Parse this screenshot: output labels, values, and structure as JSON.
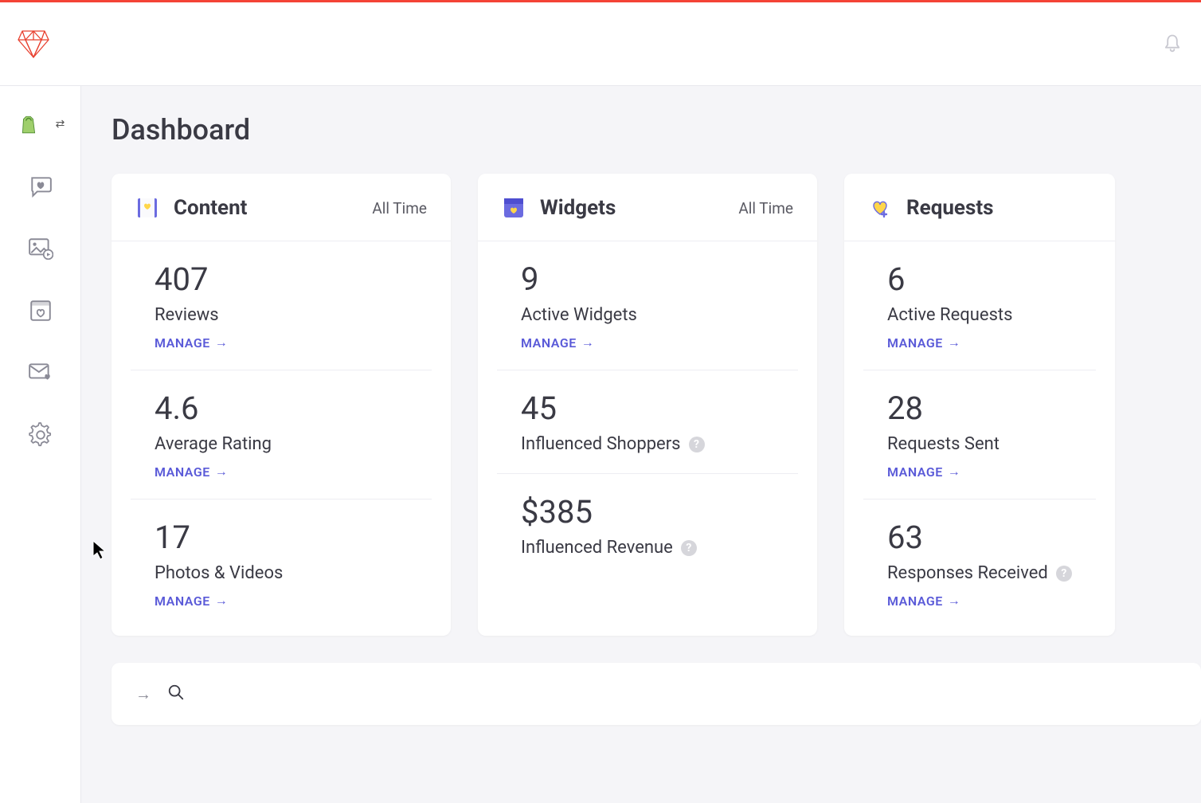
{
  "page": {
    "title": "Dashboard"
  },
  "common": {
    "manage_label": "MANAGE",
    "help_glyph": "?"
  },
  "cards": {
    "content": {
      "title": "Content",
      "range": "All Time",
      "metrics": [
        {
          "value": "407",
          "label": "Reviews",
          "has_help": false,
          "has_manage": true
        },
        {
          "value": "4.6",
          "label": "Average Rating",
          "has_help": false,
          "has_manage": true
        },
        {
          "value": "17",
          "label": "Photos & Videos",
          "has_help": false,
          "has_manage": true
        }
      ]
    },
    "widgets": {
      "title": "Widgets",
      "range": "All Time",
      "metrics": [
        {
          "value": "9",
          "label": "Active Widgets",
          "has_help": false,
          "has_manage": true
        },
        {
          "value": "45",
          "label": "Influenced Shoppers",
          "has_help": true,
          "has_manage": false
        },
        {
          "value": "$385",
          "label": "Influenced Revenue",
          "has_help": true,
          "has_manage": false
        }
      ]
    },
    "requests": {
      "title": "Requests",
      "range": "",
      "metrics": [
        {
          "value": "6",
          "label": "Active Requests",
          "has_help": false,
          "has_manage": true
        },
        {
          "value": "28",
          "label": "Requests Sent",
          "has_help": false,
          "has_manage": true
        },
        {
          "value": "63",
          "label": "Responses Received",
          "has_help": true,
          "has_manage": true
        }
      ]
    }
  }
}
